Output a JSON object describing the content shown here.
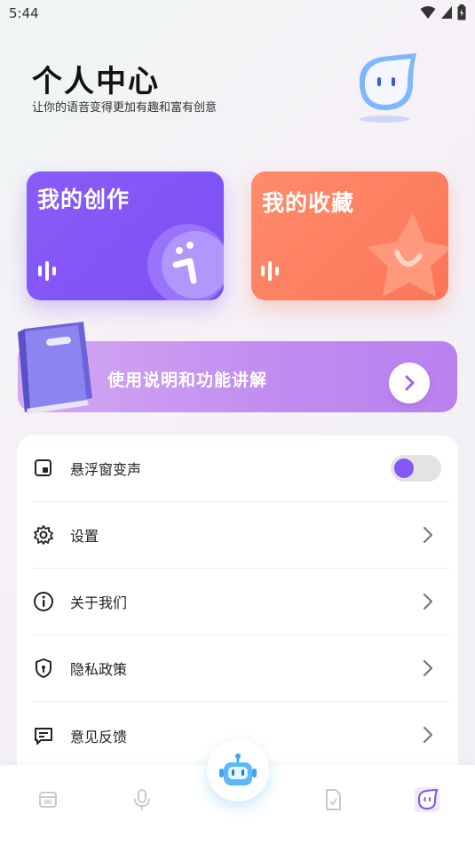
{
  "status_bar": {
    "time": "5:44"
  },
  "header": {
    "title": "个人中心",
    "subtitle": "让你的语音变得更加有趣和富有创意"
  },
  "cards": {
    "creations": {
      "title": "我的创作"
    },
    "favorites": {
      "title": "我的收藏"
    }
  },
  "guide_banner": {
    "text": "使用说明和功能讲解"
  },
  "menu": {
    "items": [
      {
        "label": "悬浮窗变声",
        "icon": "floating-window-icon",
        "control": "toggle",
        "toggle_on": false
      },
      {
        "label": "设置",
        "icon": "gear-icon",
        "control": "chevron"
      },
      {
        "label": "关于我们",
        "icon": "info-icon",
        "control": "chevron"
      },
      {
        "label": "隐私政策",
        "icon": "shield-icon",
        "control": "chevron"
      },
      {
        "label": "意见反馈",
        "icon": "feedback-icon",
        "control": "chevron"
      }
    ]
  },
  "bottom_nav": {
    "items": [
      {
        "icon": "home-icon",
        "active": false
      },
      {
        "icon": "microphone-icon",
        "active": false
      },
      {
        "icon": "robot-icon",
        "active": false
      },
      {
        "icon": "document-icon",
        "active": false
      },
      {
        "icon": "profile-mascot-icon",
        "active": true
      }
    ]
  },
  "colors": {
    "accent": "#8557f5",
    "card_create": "#7a4ff2",
    "card_favorite": "#fb7558",
    "banner": "#c08cf0"
  }
}
